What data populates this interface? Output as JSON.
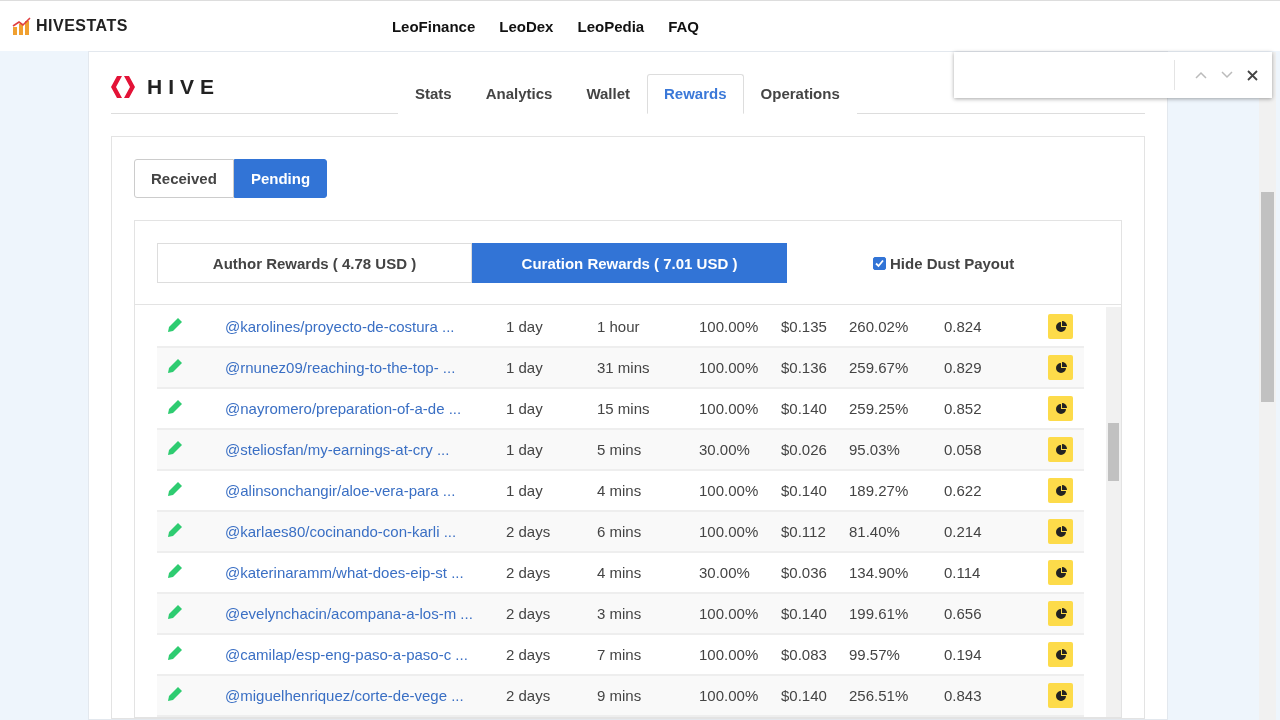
{
  "header": {
    "brand": "HIVESTATS",
    "nav": [
      "LeoFinance",
      "LeoDex",
      "LeoPedia",
      "FAQ"
    ]
  },
  "card": {
    "logo": "HIVE",
    "tabs": [
      {
        "label": "Stats",
        "selected": false
      },
      {
        "label": "Analytics",
        "selected": false
      },
      {
        "label": "Wallet",
        "selected": false
      },
      {
        "label": "Rewards",
        "selected": true
      },
      {
        "label": "Operations",
        "selected": false
      }
    ]
  },
  "period_toggle": [
    {
      "label": "Received",
      "selected": false
    },
    {
      "label": "Pending",
      "selected": true
    }
  ],
  "reward_tabs": [
    {
      "label": "Author Rewards ( 4.78 USD )",
      "selected": false
    },
    {
      "label": "Curation Rewards ( 7.01 USD )",
      "selected": true
    }
  ],
  "hide_dust": {
    "label": "Hide Dust Payout",
    "checked": true
  },
  "rows": [
    {
      "post": "@karolines/proyecto-de-costura ...",
      "age": "1 day",
      "vote_time": "1 hour",
      "weight": "100.00%",
      "value": "$0.135",
      "efficiency": "260.02%",
      "reward": "0.824"
    },
    {
      "post": "@rnunez09/reaching-to-the-top- ...",
      "age": "1 day",
      "vote_time": "31 mins",
      "weight": "100.00%",
      "value": "$0.136",
      "efficiency": "259.67%",
      "reward": "0.829"
    },
    {
      "post": "@nayromero/preparation-of-a-de ...",
      "age": "1 day",
      "vote_time": "15 mins",
      "weight": "100.00%",
      "value": "$0.140",
      "efficiency": "259.25%",
      "reward": "0.852"
    },
    {
      "post": "@steliosfan/my-earnings-at-cry ...",
      "age": "1 day",
      "vote_time": "5 mins",
      "weight": "30.00%",
      "value": "$0.026",
      "efficiency": "95.03%",
      "reward": "0.058"
    },
    {
      "post": "@alinsonchangir/aloe-vera-para ...",
      "age": "1 day",
      "vote_time": "4 mins",
      "weight": "100.00%",
      "value": "$0.140",
      "efficiency": "189.27%",
      "reward": "0.622"
    },
    {
      "post": "@karlaes80/cocinando-con-karli ...",
      "age": "2 days",
      "vote_time": "6 mins",
      "weight": "100.00%",
      "value": "$0.112",
      "efficiency": "81.40%",
      "reward": "0.214"
    },
    {
      "post": "@katerinaramm/what-does-eip-st ...",
      "age": "2 days",
      "vote_time": "4 mins",
      "weight": "30.00%",
      "value": "$0.036",
      "efficiency": "134.90%",
      "reward": "0.114"
    },
    {
      "post": "@evelynchacin/acompana-a-los-m ...",
      "age": "2 days",
      "vote_time": "3 mins",
      "weight": "100.00%",
      "value": "$0.140",
      "efficiency": "199.61%",
      "reward": "0.656"
    },
    {
      "post": "@camilap/esp-eng-paso-a-paso-c ...",
      "age": "2 days",
      "vote_time": "7 mins",
      "weight": "100.00%",
      "value": "$0.083",
      "efficiency": "99.57%",
      "reward": "0.194"
    },
    {
      "post": "@miguelhenriquez/corte-de-vege ...",
      "age": "2 days",
      "vote_time": "9 mins",
      "weight": "100.00%",
      "value": "$0.140",
      "efficiency": "256.51%",
      "reward": "0.843"
    }
  ]
}
